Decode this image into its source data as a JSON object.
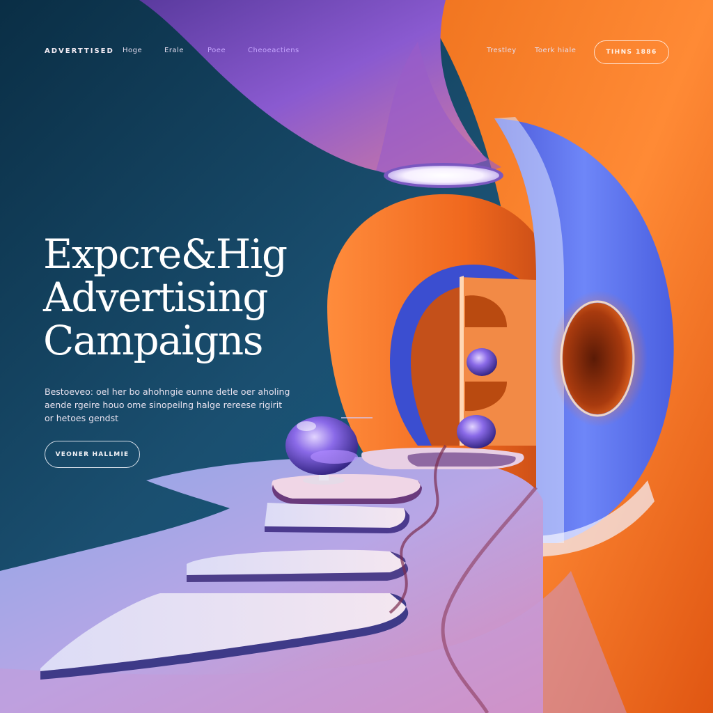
{
  "brand": {
    "name": "ADVERTTISED"
  },
  "nav": {
    "links": [
      {
        "label": "Hoge"
      },
      {
        "label": "Erale"
      },
      {
        "label": "Poee"
      },
      {
        "label": "Cheoeactiens"
      },
      {
        "label": "Trestley"
      },
      {
        "label": "Toerk hiale"
      }
    ],
    "cta_label": "TIHNS 1886"
  },
  "hero": {
    "title_lines": [
      "Expcre&Hig",
      "Advertising",
      "Campaigns"
    ],
    "description_lines": [
      "Bestoeveo: oel her bo ahohngie eunne detle oer aholing",
      "aende rgeire houo ome sinopeilng halge rereese rigirit",
      "or hetoes gendst"
    ],
    "cta_label": "VEONER HALLMIE"
  },
  "colors": {
    "teal_dark": "#0c3550",
    "teal": "#1c6a8c",
    "purple": "#7a56c8",
    "lavender": "#c8b6ee",
    "orange": "#f06a1e",
    "orange_light": "#ff9a4a",
    "blue_violet": "#5a6ef0"
  }
}
